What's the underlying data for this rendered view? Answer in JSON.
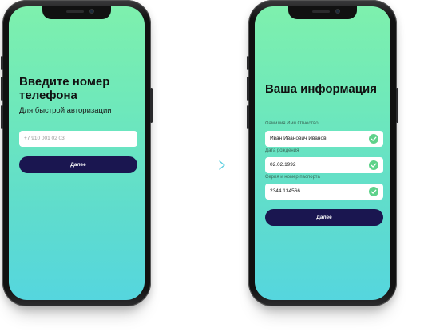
{
  "colors": {
    "accent_button": "#1a1650",
    "gradient_top": "#7ef0ad",
    "gradient_bottom": "#55d6de",
    "check": "#5ed28a",
    "arrow": "#5ecfe0"
  },
  "screen1": {
    "title": "Введите номер телефона",
    "subtitle": "Для быстрой авторизации",
    "phone_placeholder": "+7 910 001 02 03",
    "button_label": "Далее"
  },
  "screen2": {
    "title": "Ваша информация",
    "fields": [
      {
        "label": "Фамилия Имя Отчество",
        "value": "Иван Иванович Иванов",
        "icon": "check-icon"
      },
      {
        "label": "Дата рождения",
        "value": "02.02.1992",
        "icon": "check-icon"
      },
      {
        "label": "Серия и номер паспорта",
        "value": "2344 134566",
        "icon": "check-icon"
      }
    ],
    "button_label": "Далее"
  },
  "transition_icon": "arrow-right-icon"
}
